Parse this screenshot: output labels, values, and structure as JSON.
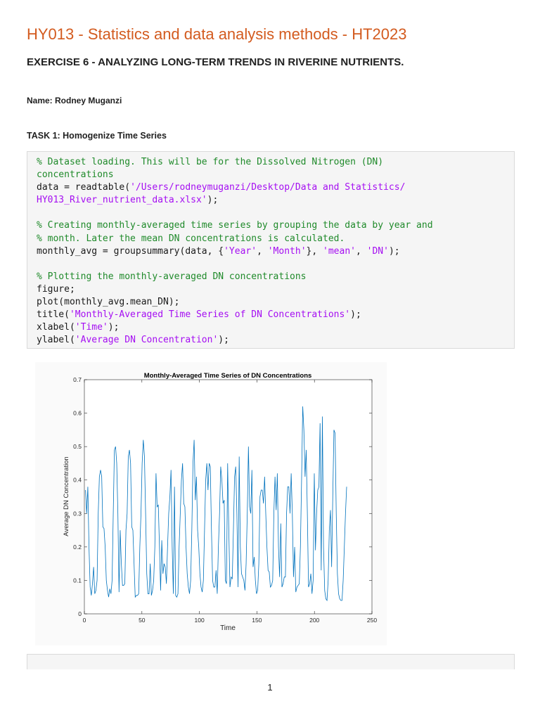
{
  "header": {
    "title": "HY013 - Statistics and data analysis methods - HT2023",
    "exercise": "EXERCISE 6 - ANALYZING LONG-TERM TRENDS IN RIVERINE NUTRIENTS.",
    "name": "Name: Rodney Muganzi",
    "task": "TASK 1: Homogenize Time Series"
  },
  "code": [
    [
      {
        "t": "% Dataset loading. This will be for the Dissolved Nitrogen (DN)",
        "c": "comment"
      }
    ],
    [
      {
        "t": "concentrations",
        "c": "comment"
      }
    ],
    [
      {
        "t": "data = readtable(",
        "c": "plain"
      },
      {
        "t": "'/Users/rodneymuganzi/Desktop/Data and Statistics/",
        "c": "string"
      }
    ],
    [
      {
        "t": "HY013_River_nutrient_data.xlsx'",
        "c": "string"
      },
      {
        "t": ");",
        "c": "plain"
      }
    ],
    [],
    [
      {
        "t": "% Creating monthly-averaged time series by grouping the data by year and",
        "c": "comment"
      }
    ],
    [
      {
        "t": "% month. Later the mean DN concentrations is calculated.",
        "c": "comment"
      }
    ],
    [
      {
        "t": "monthly_avg = groupsummary(data, {",
        "c": "plain"
      },
      {
        "t": "'Year'",
        "c": "string"
      },
      {
        "t": ", ",
        "c": "plain"
      },
      {
        "t": "'Month'",
        "c": "string"
      },
      {
        "t": "}, ",
        "c": "plain"
      },
      {
        "t": "'mean'",
        "c": "string"
      },
      {
        "t": ", ",
        "c": "plain"
      },
      {
        "t": "'DN'",
        "c": "string"
      },
      {
        "t": ");",
        "c": "plain"
      }
    ],
    [],
    [
      {
        "t": "% Plotting the monthly-averaged DN concentrations",
        "c": "comment"
      }
    ],
    [
      {
        "t": "figure;",
        "c": "plain"
      }
    ],
    [
      {
        "t": "plot(monthly_avg.mean_DN);",
        "c": "plain"
      }
    ],
    [
      {
        "t": "title(",
        "c": "plain"
      },
      {
        "t": "'Monthly-Averaged Time Series of DN Concentrations'",
        "c": "string"
      },
      {
        "t": ");",
        "c": "plain"
      }
    ],
    [
      {
        "t": "xlabel(",
        "c": "plain"
      },
      {
        "t": "'Time'",
        "c": "string"
      },
      {
        "t": ");",
        "c": "plain"
      }
    ],
    [
      {
        "t": "ylabel(",
        "c": "plain"
      },
      {
        "t": "'Average DN Concentration'",
        "c": "string"
      },
      {
        "t": ");",
        "c": "plain"
      }
    ]
  ],
  "colors": {
    "title": "#d35b1f",
    "comment": "#1f8a2a",
    "string": "#a50ef2",
    "line": "#0072bd"
  },
  "chart_data": {
    "type": "line",
    "title": "Monthly-Averaged Time Series of DN Concentrations",
    "xlabel": "Time",
    "ylabel": "Average DN Concentration",
    "xlim": [
      0,
      250
    ],
    "ylim": [
      0,
      0.7
    ],
    "xticks": [
      "0",
      "50",
      "100",
      "150",
      "200",
      "250"
    ],
    "yticks": [
      "0",
      "0.1",
      "0.2",
      "0.3",
      "0.4",
      "0.5",
      "0.6",
      "0.7"
    ],
    "x_start": 1,
    "series": [
      {
        "name": "mean_DN",
        "values": [
          0.37,
          0.3,
          0.38,
          0.2,
          0.08,
          0.055,
          0.09,
          0.14,
          0.06,
          0.07,
          0.1,
          0.3,
          0.41,
          0.43,
          0.41,
          0.26,
          0.255,
          0.2,
          0.1,
          0.07,
          0.05,
          0.075,
          0.06,
          0.1,
          0.3,
          0.49,
          0.5,
          0.45,
          0.3,
          0.065,
          0.25,
          0.15,
          0.085,
          0.085,
          0.09,
          0.25,
          0.3,
          0.47,
          0.49,
          0.45,
          0.26,
          0.25,
          0.15,
          0.05,
          0.055,
          0.055,
          0.06,
          0.2,
          0.3,
          0.45,
          0.52,
          0.47,
          0.3,
          0.12,
          0.06,
          0.06,
          0.15,
          0.055,
          0.07,
          0.1,
          0.2,
          0.42,
          0.32,
          0.325,
          0.2,
          0.07,
          0.22,
          0.12,
          0.15,
          0.14,
          0.09,
          0.2,
          0.3,
          0.35,
          0.43,
          0.2,
          0.06,
          0.38,
          0.055,
          0.05,
          0.06,
          0.2,
          0.3,
          0.4,
          0.45,
          0.33,
          0.32,
          0.2,
          0.12,
          0.08,
          0.06,
          0.1,
          0.25,
          0.45,
          0.52,
          0.34,
          0.41,
          0.25,
          0.2,
          0.12,
          0.08,
          0.065,
          0.1,
          0.25,
          0.4,
          0.45,
          0.37,
          0.45,
          0.44,
          0.25,
          0.1,
          0.08,
          0.08,
          0.13,
          0.06,
          0.2,
          0.3,
          0.44,
          0.4,
          0.33,
          0.34,
          0.1,
          0.09,
          0.45,
          0.25,
          0.08,
          0.11,
          0.105,
          0.25,
          0.41,
          0.44,
          0.3,
          0.08,
          0.47,
          0.2,
          0.12,
          0.11,
          0.1,
          0.07,
          0.15,
          0.3,
          0.5,
          0.32,
          0.3,
          0.43,
          0.14,
          0.17,
          0.1,
          0.06,
          0.07,
          0.15,
          0.35,
          0.37,
          0.37,
          0.33,
          0.41,
          0.3,
          0.2,
          0.13,
          0.125,
          0.08,
          0.085,
          0.1,
          0.3,
          0.41,
          0.31,
          0.42,
          0.2,
          0.11,
          0.27,
          0.08,
          0.09,
          0.11,
          0.11,
          0.3,
          0.38,
          0.38,
          0.3,
          0.42,
          0.3,
          0.11,
          0.2,
          0.065,
          0.08,
          0.085,
          0.09,
          0.2,
          0.4,
          0.62,
          0.55,
          0.41,
          0.49,
          0.3,
          0.08,
          0.09,
          0.12,
          0.06,
          0.1,
          0.42,
          0.19,
          0.3,
          0.37,
          0.38,
          0.57,
          0.13,
          0.59,
          0.2,
          0.07,
          0.045,
          0.04,
          0.1,
          0.25,
          0.31,
          0.14,
          0.35,
          0.55,
          0.54,
          0.3,
          0.12,
          0.06,
          0.045,
          0.04,
          0.04,
          0.1,
          0.2,
          0.3,
          0.38
        ]
      }
    ]
  },
  "footer": {
    "page": "1"
  }
}
